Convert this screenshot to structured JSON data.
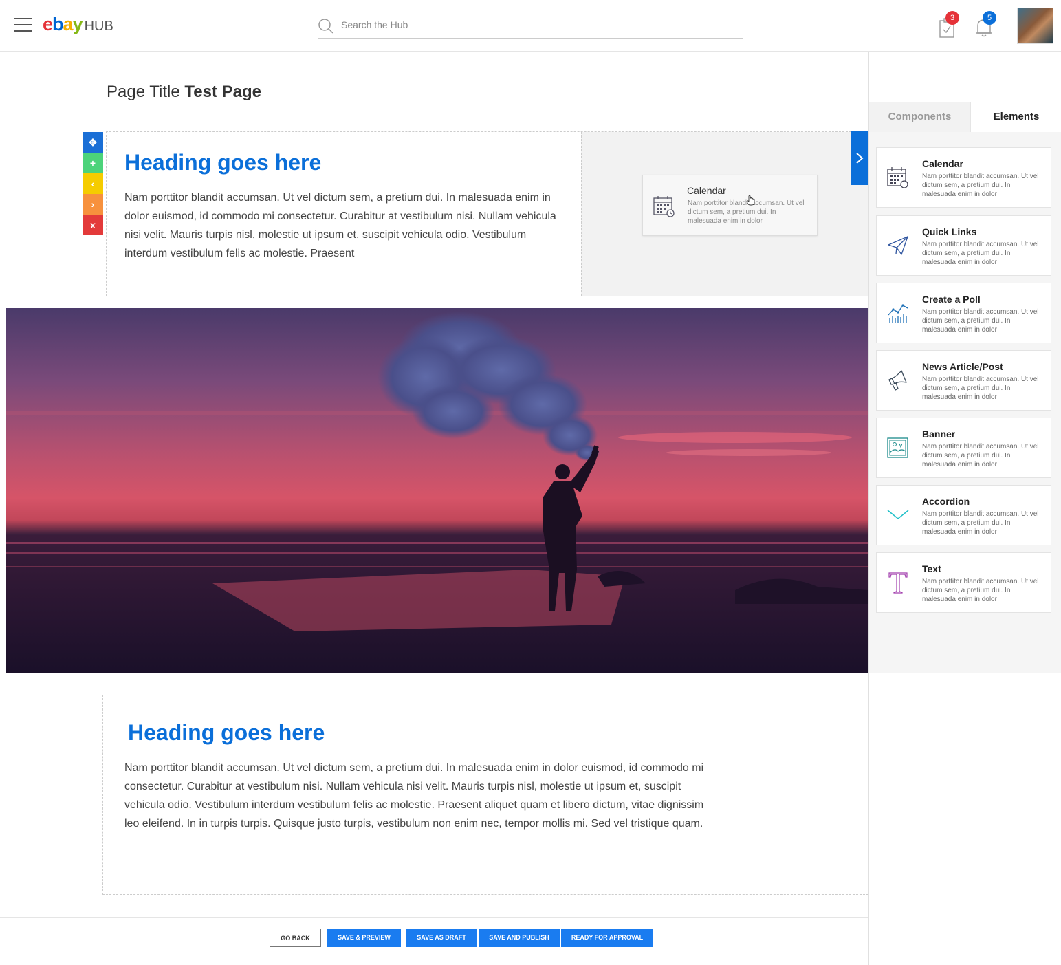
{
  "header": {
    "logo": {
      "e": "e",
      "b": "b",
      "a": "a",
      "y": "y",
      "hub": "HUB"
    },
    "search_placeholder": "Search the Hub",
    "tasks_badge": "3",
    "notifications_badge": "5"
  },
  "page": {
    "title_prefix": "Page Title",
    "title_name": "Test Page"
  },
  "block_tools": [
    "✥",
    "+",
    "‹",
    "›",
    "x"
  ],
  "block1": {
    "heading": "Heading goes here",
    "body": "Nam porttitor blandit accumsan. Ut vel dictum sem, a pretium dui. In malesuada enim in dolor euismod, id commodo mi consectetur. Curabitur at vestibulum nisi. Nullam vehicula nisi velit. Mauris turpis nisl, molestie ut ipsum et, suscipit vehicula odio. Vestibulum interdum vestibulum felis ac molestie. Praesent"
  },
  "dragging_card": {
    "title": "Calendar",
    "desc": "Nam porttitor blandit accumsan. Ut vel dictum sem, a pretium dui. In malesuada enim in dolor"
  },
  "block2": {
    "heading": "Heading goes here",
    "body": "Nam porttitor blandit accumsan. Ut vel dictum sem, a pretium dui. In malesuada enim in dolor euismod, id commodo mi consectetur. Curabitur at vestibulum nisi. Nullam vehicula nisi velit. Mauris turpis nisl, molestie ut ipsum et, suscipit vehicula odio. Vestibulum interdum vestibulum felis ac molestie. Praesent aliquet quam et libero dictum, vitae dignissim leo eleifend. In in turpis turpis. Quisque justo turpis, vestibulum non enim nec, tempor mollis mi. Sed vel tristique quam."
  },
  "sidepanel": {
    "tabs": [
      "Components",
      "Elements"
    ],
    "active_tab": "Elements",
    "items": [
      {
        "title": "Calendar",
        "desc": "Nam porttitor blandit accumsan. Ut vel dictum sem, a pretium dui. In malesuada enim in dolor",
        "icon": "calendar-icon"
      },
      {
        "title": "Quick Links",
        "desc": "Nam porttitor blandit accumsan. Ut vel dictum sem, a pretium dui. In malesuada enim in dolor",
        "icon": "paper-plane-icon"
      },
      {
        "title": "Create a Poll",
        "desc": "Nam porttitor blandit accumsan. Ut vel dictum sem, a pretium dui. In malesuada enim in dolor",
        "icon": "poll-chart-icon"
      },
      {
        "title": "News Article/Post",
        "desc": "Nam porttitor blandit accumsan. Ut vel dictum sem, a pretium dui. In malesuada enim in dolor",
        "icon": "megaphone-icon"
      },
      {
        "title": "Banner",
        "desc": "Nam porttitor blandit accumsan. Ut vel dictum sem, a pretium dui. In malesuada enim in dolor",
        "icon": "banner-image-icon"
      },
      {
        "title": "Accordion",
        "desc": "Nam porttitor blandit accumsan. Ut vel dictum sem, a pretium dui. In malesuada enim in dolor",
        "icon": "chevron-down-icon"
      },
      {
        "title": "Text",
        "desc": "Nam porttitor blandit accumsan. Ut vel dictum sem, a pretium dui. In malesuada enim in dolor",
        "icon": "text-icon"
      }
    ]
  },
  "footer": {
    "go_back": "GO BACK",
    "save_preview": "SAVE & PREVIEW",
    "save_draft": "SAVE AS DRAFT",
    "save_publish": "SAVE AND PUBLISH",
    "ready_approval": "READY FOR APPROVAL"
  },
  "colors": {
    "accent": "#0b6fd9",
    "button_primary": "#1a7cf0",
    "tool_move": "#1a6fd6",
    "tool_add": "#4cd37a",
    "tool_left": "#f5cc00",
    "tool_right": "#f7913d",
    "tool_delete": "#e33a3a"
  }
}
